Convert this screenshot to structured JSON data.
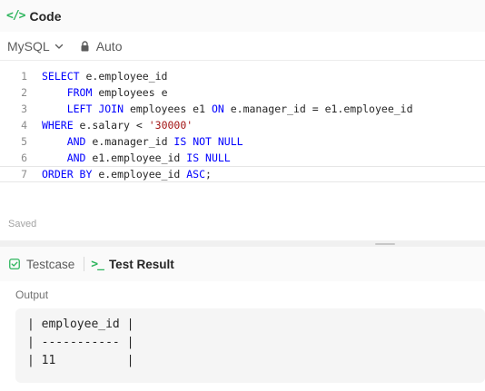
{
  "header": {
    "icon": "code-tag-icon",
    "title": "Code"
  },
  "toolbar": {
    "language": "MySQL",
    "mode": "Auto"
  },
  "editor": {
    "lines": [
      {
        "num": "1",
        "tokens": [
          {
            "t": "SELECT",
            "c": "kw"
          },
          {
            "t": " e.employee_id",
            "c": ""
          }
        ]
      },
      {
        "num": "2",
        "tokens": [
          {
            "t": "    ",
            "c": ""
          },
          {
            "t": "FROM",
            "c": "kw"
          },
          {
            "t": " employees e",
            "c": ""
          }
        ]
      },
      {
        "num": "3",
        "tokens": [
          {
            "t": "    ",
            "c": ""
          },
          {
            "t": "LEFT JOIN",
            "c": "kw"
          },
          {
            "t": " employees e1 ",
            "c": ""
          },
          {
            "t": "ON",
            "c": "kw"
          },
          {
            "t": " e.manager_id = e1.employee_id",
            "c": ""
          }
        ]
      },
      {
        "num": "4",
        "tokens": [
          {
            "t": "WHERE",
            "c": "kw"
          },
          {
            "t": " e.salary < ",
            "c": ""
          },
          {
            "t": "'30000'",
            "c": "str"
          }
        ]
      },
      {
        "num": "5",
        "tokens": [
          {
            "t": "    ",
            "c": ""
          },
          {
            "t": "AND",
            "c": "kw"
          },
          {
            "t": " e.manager_id ",
            "c": ""
          },
          {
            "t": "IS NOT NULL",
            "c": "kw"
          }
        ]
      },
      {
        "num": "6",
        "tokens": [
          {
            "t": "    ",
            "c": ""
          },
          {
            "t": "AND",
            "c": "kw"
          },
          {
            "t": " e1.employee_id ",
            "c": ""
          },
          {
            "t": "IS NULL",
            "c": "kw"
          }
        ]
      },
      {
        "num": "7",
        "tokens": [
          {
            "t": "ORDER BY",
            "c": "kw"
          },
          {
            "t": " e.employee_id ",
            "c": ""
          },
          {
            "t": "ASC",
            "c": "kw"
          },
          {
            "t": ";",
            "c": ""
          }
        ]
      }
    ],
    "current_line": 7
  },
  "status": {
    "saved": "Saved"
  },
  "tabs": [
    {
      "label": "Testcase",
      "active": false
    },
    {
      "label": "Test Result",
      "active": true
    }
  ],
  "output": {
    "label": "Output",
    "lines": [
      "| employee_id |",
      "| ----------- |",
      "| 11          |"
    ]
  },
  "colors": {
    "accent": "#2db55d",
    "keyword": "#0000ff",
    "string": "#a31515"
  }
}
